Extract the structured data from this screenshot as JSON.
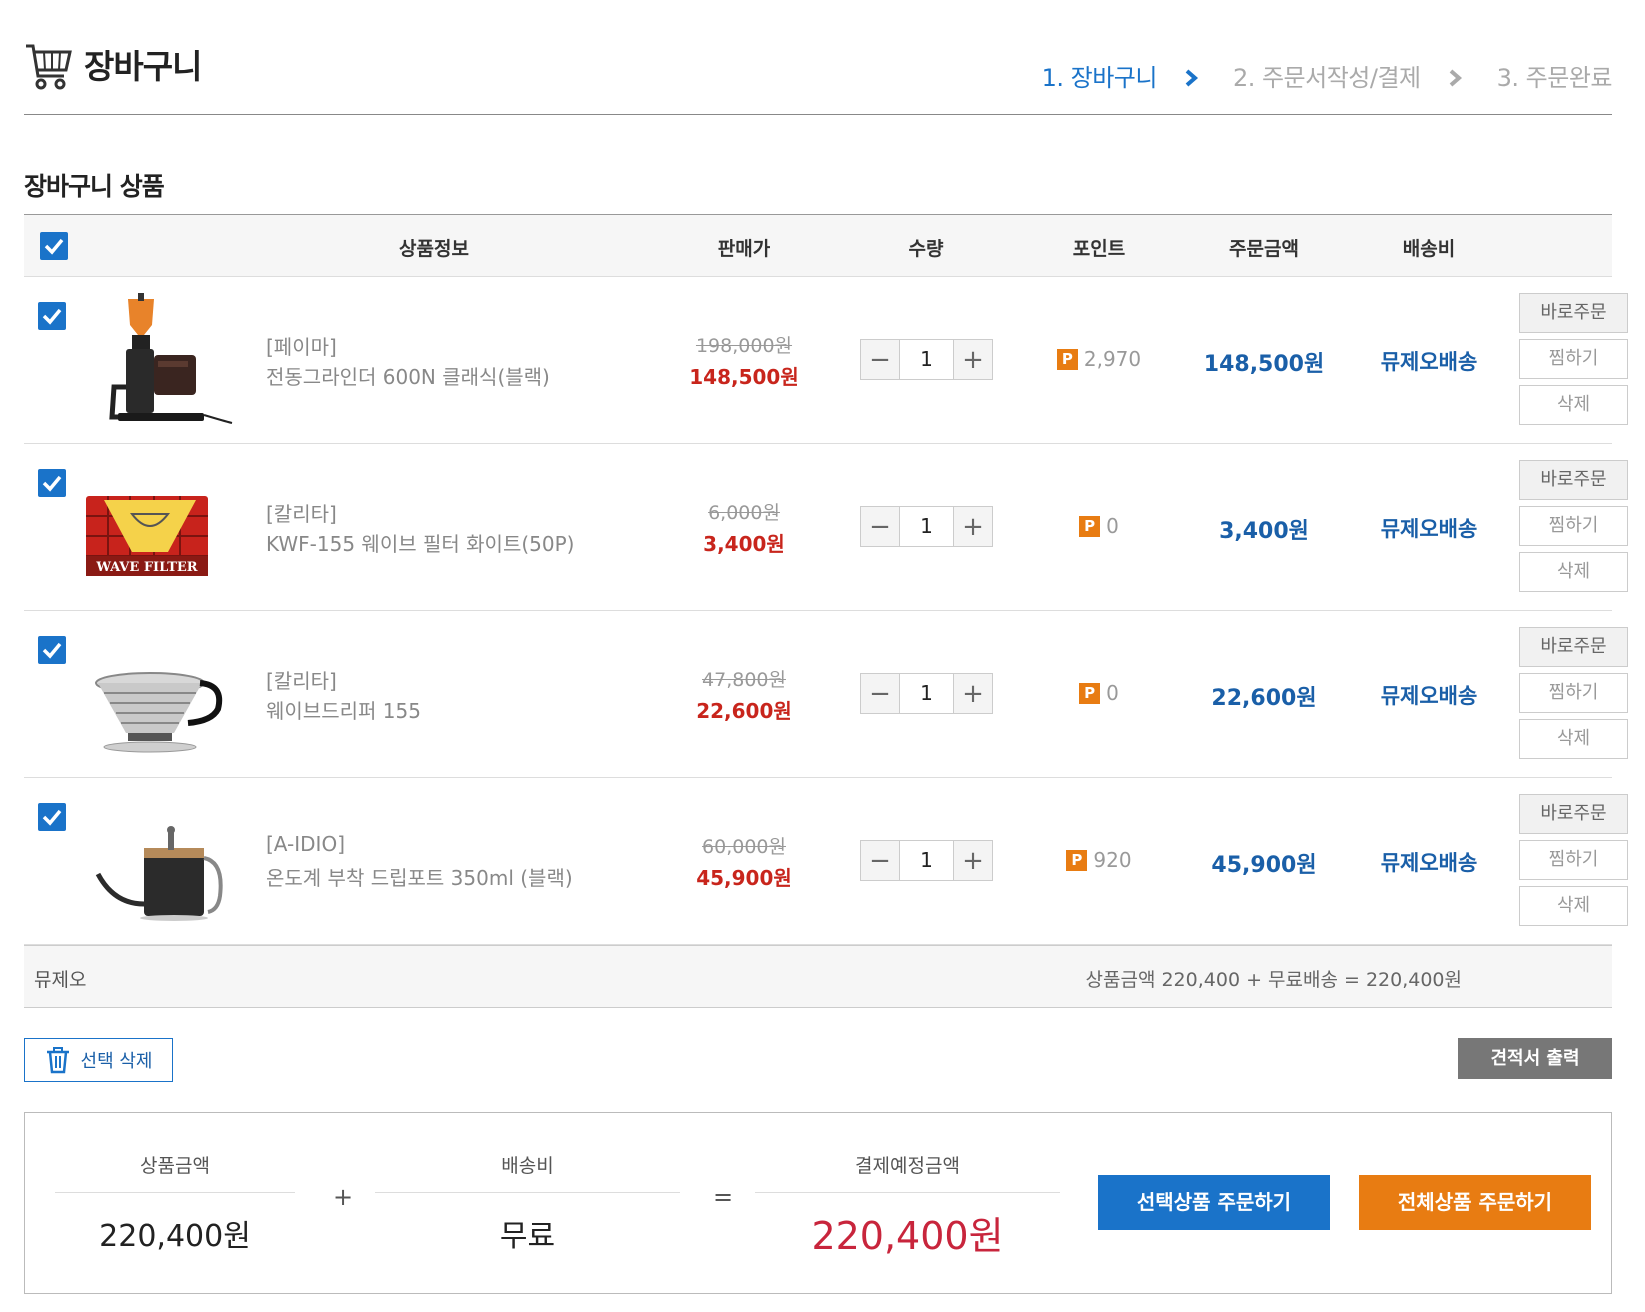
{
  "header": {
    "title": "장바구니",
    "steps": [
      "1. 장바구니",
      "2. 주문서작성/결제",
      "3. 주문완료"
    ]
  },
  "section_title": "장바구니 상품",
  "table": {
    "headers": [
      "상품정보",
      "판매가",
      "수량",
      "포인트",
      "주문금액",
      "배송비"
    ]
  },
  "items": [
    {
      "brand": "[페이마]",
      "name": "전동그라인더 600N 클래식(블랙)",
      "orig_price": "198,000원",
      "sale_price": "148,500원",
      "qty": "1",
      "point": "2,970",
      "order_amount": "148,500원",
      "shipping": "뮤제오배송",
      "checked": true
    },
    {
      "brand": "[칼리타]",
      "name": "KWF-155 웨이브 필터 화이트(50P)",
      "orig_price": "6,000원",
      "sale_price": "3,400원",
      "qty": "1",
      "point": "0",
      "order_amount": "3,400원",
      "shipping": "뮤제오배송",
      "checked": true
    },
    {
      "brand": "[칼리타]",
      "name": "웨이브드리퍼 155",
      "orig_price": "47,800원",
      "sale_price": "22,600원",
      "qty": "1",
      "point": "0",
      "order_amount": "22,600원",
      "shipping": "뮤제오배송",
      "checked": true
    },
    {
      "brand": "[A-IDIO]",
      "name": "온도계 부착 드립포트 350ml (블랙)",
      "orig_price": "60,000원",
      "sale_price": "45,900원",
      "qty": "1",
      "point": "920",
      "order_amount": "45,900원",
      "shipping": "뮤제오배송",
      "checked": true
    }
  ],
  "actions": {
    "buy_now": "바로주문",
    "wishlist": "찜하기",
    "delete": "삭제"
  },
  "point_badge": "P",
  "subtotal": {
    "seller": "뮤제오",
    "formula": "상품금액 220,400 + 무료배송 = 220,400원"
  },
  "buttons": {
    "delete_selected": "선택 삭제",
    "print_quote": "견적서 출력",
    "order_selected": "선택상품 주문하기",
    "order_all": "전체상품 주문하기"
  },
  "summary": {
    "product_label": "상품금액",
    "product_value": "220,400원",
    "plus": "+",
    "shipping_label": "배송비",
    "shipping_value": "무료",
    "equals": "=",
    "total_label": "결제예정금액",
    "total_value": "220,400원"
  },
  "colors": {
    "accent": "#1a73c9",
    "order_amount": "#1a5fa8",
    "sale_price": "#c8251c",
    "total": "#c8253c",
    "orange": "#e87c12",
    "quote": "#777777"
  }
}
